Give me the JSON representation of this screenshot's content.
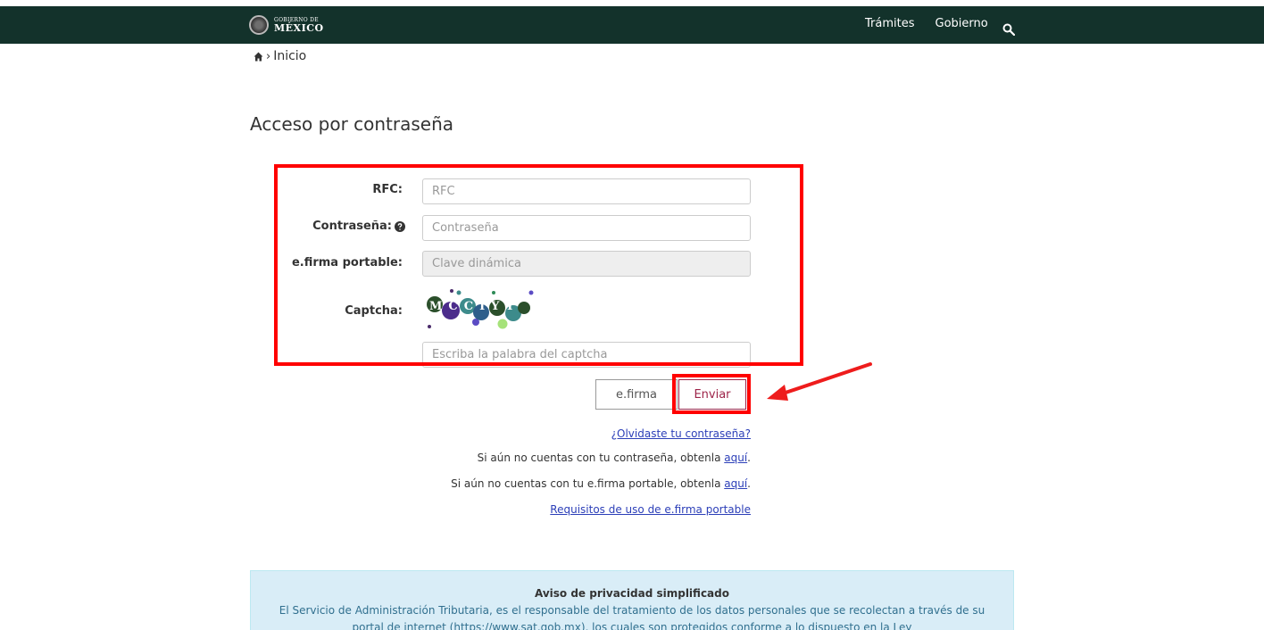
{
  "header": {
    "logo_small": "GOBIERNO DE",
    "logo_big": "MÉXICO",
    "nav": [
      "Trámites",
      "Gobierno"
    ],
    "search_icon": "search-icon",
    "bg_color": "#13322b"
  },
  "breadcrumb": {
    "home_icon": "home-icon",
    "current": "Inicio"
  },
  "page": {
    "title": "Acceso por contraseña"
  },
  "form": {
    "rfc_label": "RFC:",
    "rfc_placeholder": "RFC",
    "password_label": "Contraseña:",
    "password_placeholder": "Contraseña",
    "efirma_label": "e.firma portable:",
    "efirma_placeholder": "Clave dinámica",
    "captcha_label": "Captcha:",
    "captcha_placeholder": "Escriba la palabra del captcha",
    "captcha_text": "MCCIYY"
  },
  "buttons": {
    "efirma": "e.firma",
    "send": "Enviar",
    "send_color": "#9d2449"
  },
  "links": {
    "forgot": "¿Olvidaste tu contraseña?",
    "no_password_text": "Si aún no cuentas con tu contraseña, obtenla ",
    "no_password_link": "aquí",
    "no_efirma_text": "Si aún no cuentas con tu e.firma portable, obtenla ",
    "no_efirma_link": "aquí",
    "requirements": "Requisitos de uso de e.firma portable"
  },
  "privacy": {
    "title": "Aviso de privacidad simplificado",
    "text": "El Servicio de Administración Tributaria, es el responsable del tratamiento de los datos personales que se recolectan a través de su portal de internet (https://www.sat.gob.mx), los cuales son protegidos conforme a lo dispuesto en la Ley"
  },
  "annotations": {
    "highlight_color": "#ff0000"
  }
}
